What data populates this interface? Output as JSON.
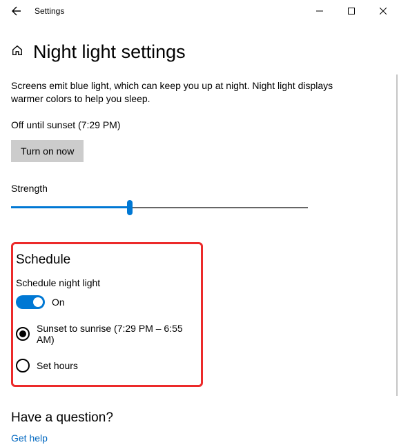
{
  "titlebar": {
    "title": "Settings"
  },
  "page": {
    "title": "Night light settings",
    "description": "Screens emit blue light, which can keep you up at night. Night light displays warmer colors to help you sleep.",
    "status": "Off until sunset (7:29 PM)",
    "turn_on_label": "Turn on now"
  },
  "strength": {
    "label": "Strength",
    "value_percent": 40
  },
  "schedule": {
    "title": "Schedule",
    "toggle_label": "Schedule night light",
    "toggle_state": "On",
    "option_sunset": "Sunset to sunrise (7:29 PM – 6:55 AM)",
    "option_set_hours": "Set hours"
  },
  "question": {
    "title": "Have a question?",
    "link": "Get help"
  }
}
